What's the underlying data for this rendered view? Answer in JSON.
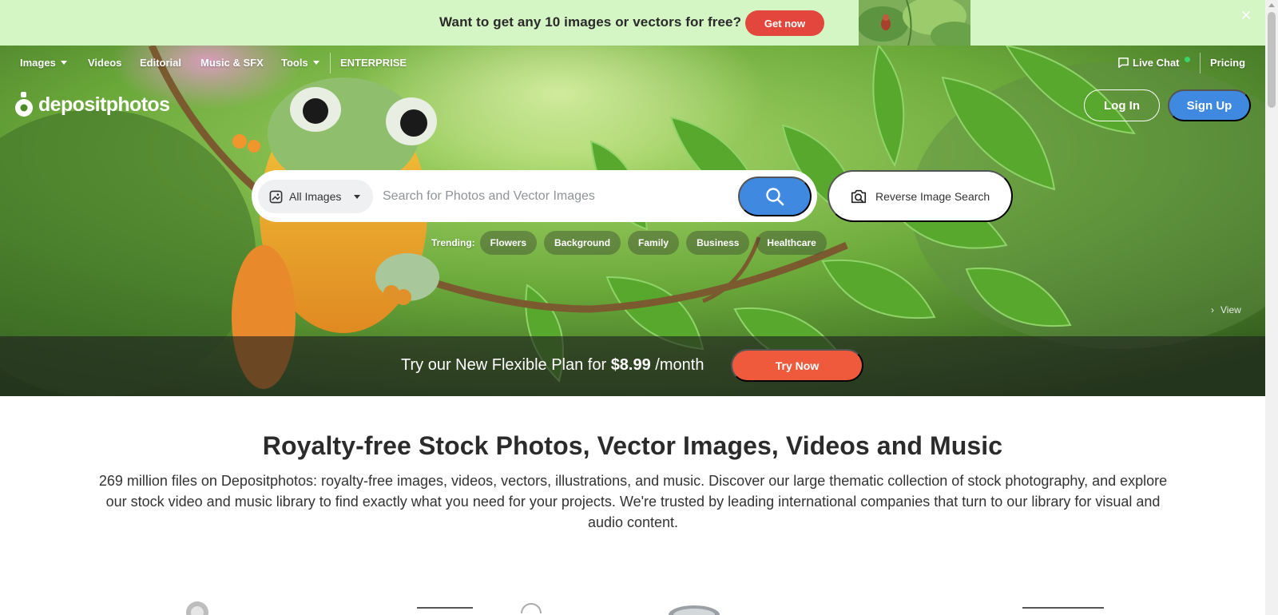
{
  "promo": {
    "text": "Want to get any 10 images or vectors for free?",
    "button": "Get now",
    "close_icon": "close-icon"
  },
  "nav": {
    "items": [
      {
        "label": "Images",
        "dropdown": true
      },
      {
        "label": "Videos"
      },
      {
        "label": "Editorial"
      },
      {
        "label": "Music & SFX"
      },
      {
        "label": "Tools",
        "dropdown": true
      },
      {
        "label": "ENTERPRISE"
      }
    ],
    "live_chat": "Live Chat",
    "pricing": "Pricing"
  },
  "brand": {
    "logo_text": "depositphotos"
  },
  "auth": {
    "login": "Log In",
    "signup": "Sign Up"
  },
  "search": {
    "type_selected": "All Images",
    "placeholder": "Search for Photos and Vector Images",
    "reverse": "Reverse Image Search"
  },
  "trending": {
    "label": "Trending:",
    "tags": [
      "Flowers",
      "Background",
      "Family",
      "Business",
      "Healthcare"
    ]
  },
  "hero": {
    "view_link": "View"
  },
  "plan": {
    "text_before": "Try our New Flexible Plan for ",
    "price": "$8.99",
    "text_after": " /month",
    "button": "Try Now"
  },
  "main": {
    "headline": "Royalty-free Stock Photos, Vector Images, Videos and Music",
    "description": "269 million files on Depositphotos: royalty-free images, videos, vectors, illustrations, and music. Discover our large thematic collection of stock photography, and explore our stock video and music library to find exactly what you need for your projects. We're trusted by leading international companies that turn to our library for visual and audio content."
  },
  "colors": {
    "promo_bg": "#d4f5c4",
    "promo_button": "#e3463c",
    "primary_blue": "#3f8ae0",
    "try_now": "#f05a3c",
    "live_dot": "#3bd46b"
  }
}
